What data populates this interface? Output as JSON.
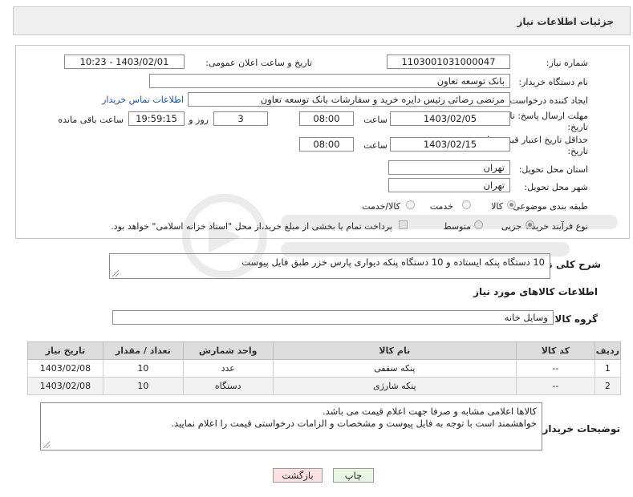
{
  "header": {
    "title": "جزئیات اطلاعات نیاز"
  },
  "form": {
    "need_number_label": "شماره نیاز:",
    "need_number": "1103001031000047",
    "announce_label": "تاریخ و ساعت اعلان عمومی:",
    "announce_value": "1403/02/01 - 10:23",
    "buyer_org_label": "نام دستگاه خریدار:",
    "buyer_org": "بانک توسعه تعاون",
    "requester_label": "ایجاد کننده درخواست:",
    "requester": "مرتضی رضائی رئیس دایره خرید و سفارشات بانک توسعه تعاون",
    "contact_link": "اطلاعات تماس خریدار",
    "deadline_label_1": "مهلت ارسال پاسخ: تا",
    "deadline_label_2": "تاریخ:",
    "deadline_date": "1403/02/05",
    "time_label": "ساعت",
    "deadline_time": "08:00",
    "days_value": "3",
    "days_label": "روز و",
    "remaining_time": "19:59:15",
    "remaining_label": "ساعت باقی مانده",
    "validity_label_1": "حداقل تاریخ اعتبار قیمت: تا",
    "validity_label_2": "تاریخ:",
    "validity_date": "1403/02/15",
    "validity_time": "08:00",
    "province_label": "استان محل تحویل:",
    "province": "تهران",
    "city_label": "شهر محل تحویل:",
    "city": "تهران",
    "category_label": "طبقه بندی موضوعی:",
    "category_options": [
      "کالا",
      "خدمت",
      "کالا/خدمت"
    ],
    "process_label": "نوع فرآیند خرید :",
    "process_options": [
      "جزیی",
      "متوسط"
    ],
    "payment_note": "پرداخت تمام یا بخشی از مبلغ خرید،از محل \"اسناد خزانه اسلامی\" خواهد بود."
  },
  "summary": {
    "label": "شرح کلی نیاز:",
    "text": "10 دستگاه پنکه ایستاده و 10 دستگاه پنکه دیواری پارس خزر طبق فایل پیوست"
  },
  "goods": {
    "section_title": "اطلاعات کالاهای مورد نیاز",
    "group_label": "گروه کالا:",
    "group_value": "وسایل خانه"
  },
  "table": {
    "headers": [
      "ردیف",
      "کد کالا",
      "نام کالا",
      "واحد شمارش",
      "تعداد / مقدار",
      "تاریخ نیاز"
    ],
    "rows": [
      [
        "1",
        "--",
        "پنکه سقفی",
        "عدد",
        "10",
        "1403/02/08"
      ],
      [
        "2",
        "--",
        "پنکه شارژی",
        "دستگاه",
        "10",
        "1403/02/08"
      ]
    ]
  },
  "buyer_notes": {
    "label": "توضیحات خریدار:",
    "line1": "کالاها اعلامی مشابه و صرفا جهت اعلام قیمت می باشد.",
    "line2": "خواهشمند است با توجه به فایل پیوست و مشخصات و الزامات درخواستی قیمت را اعلام نمایید."
  },
  "buttons": {
    "print": "چاپ",
    "back": "بازگشت"
  },
  "colors": {
    "link": "#1a4f9a",
    "back_button_bg": "#fbe1e1",
    "print_button_bg": "#e8f6e3"
  }
}
